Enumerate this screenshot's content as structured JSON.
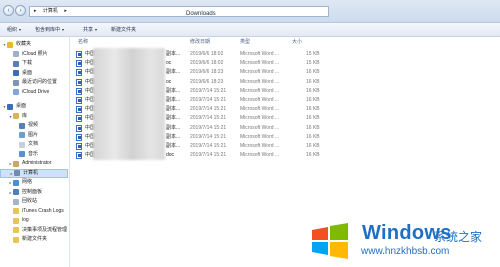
{
  "window": {
    "title": "Downloads"
  },
  "address": {
    "segments": [
      "▸",
      "计算机",
      "▸"
    ]
  },
  "toolbar": [
    {
      "label": "组织"
    },
    {
      "label": "包含到库中"
    },
    {
      "label": "共享"
    },
    {
      "label": "新建文件夹"
    }
  ],
  "sidebar": [
    {
      "label": "收藏夹",
      "indent": 0,
      "color": "#e8b830",
      "tri": "▾"
    },
    {
      "label": "iCloud 照片",
      "indent": 1,
      "color": "#9fb0c8"
    },
    {
      "label": "下载",
      "indent": 1,
      "color": "#5a7fb5"
    },
    {
      "label": "桌面",
      "indent": 1,
      "color": "#3a6fb8"
    },
    {
      "label": "最近访问的位置",
      "indent": 1,
      "color": "#7f95b8"
    },
    {
      "label": "iCloud Drive",
      "indent": 1,
      "color": "#7fa7d8"
    },
    {
      "label": "",
      "indent": 0,
      "color": "",
      "spacer": true
    },
    {
      "label": "桌面",
      "indent": 0,
      "color": "#3a6fb8",
      "tri": "▾"
    },
    {
      "label": "库",
      "indent": 1,
      "color": "#d8b45a",
      "tri": "▾"
    },
    {
      "label": "视频",
      "indent": 2,
      "color": "#5a7fb5"
    },
    {
      "label": "图片",
      "indent": 2,
      "color": "#6aa0d0"
    },
    {
      "label": "文档",
      "indent": 2,
      "color": "#c8cfd8"
    },
    {
      "label": "音乐",
      "indent": 2,
      "color": "#5b8fd0"
    },
    {
      "label": "Administrator",
      "indent": 1,
      "color": "#c8a56a",
      "tri": "▸"
    },
    {
      "label": "计算机",
      "indent": 1,
      "color": "#6f8bb0",
      "tri": "▸",
      "selected": true
    },
    {
      "label": "网络",
      "indent": 1,
      "color": "#4f8fc8",
      "tri": "▸"
    },
    {
      "label": "控制面板",
      "indent": 1,
      "color": "#4f7fb8",
      "tri": "▸"
    },
    {
      "label": "回收站",
      "indent": 1,
      "color": "#a8b4c4"
    },
    {
      "label": "iTunes Crash Logs",
      "indent": 1,
      "color": "#e8c45a"
    },
    {
      "label": "log",
      "indent": 1,
      "color": "#e8c45a"
    },
    {
      "label": "决策事项及流程管理",
      "indent": 1,
      "color": "#e8c45a"
    },
    {
      "label": "新建文件夹",
      "indent": 1,
      "color": "#e8c45a"
    }
  ],
  "columns": [
    {
      "label": "名称"
    },
    {
      "label": "修改日期"
    },
    {
      "label": "类型"
    },
    {
      "label": "大小"
    }
  ],
  "files": [
    {
      "name": "中国",
      "name2": "副本...",
      "date": "2019/6/6 18:02",
      "type": "Microsoft Word ...",
      "size": "15 KB"
    },
    {
      "name": "中国",
      "name2": "oc",
      "date": "2019/6/6 18:02",
      "type": "Microsoft Word ...",
      "size": "15 KB"
    },
    {
      "name": "中国",
      "name2": "副本...",
      "date": "2019/6/6 18:23",
      "type": "Microsoft Word ...",
      "size": "16 KB"
    },
    {
      "name": "中国",
      "name2": "oc",
      "date": "2019/6/6 18:23",
      "type": "Microsoft Word ...",
      "size": "16 KB"
    },
    {
      "name": "中国",
      "name2": "副本...",
      "date": "2019/7/14 15:21",
      "type": "Microsoft Word ...",
      "size": "16 KB"
    },
    {
      "name": "中国",
      "name2": "副本...",
      "date": "2019/7/14 15:21",
      "type": "Microsoft Word ...",
      "size": "16 KB"
    },
    {
      "name": "中国",
      "name2": "副本...",
      "date": "2019/7/14 15:21",
      "type": "Microsoft Word ...",
      "size": "16 KB"
    },
    {
      "name": "中国",
      "name2": "副本...",
      "date": "2019/7/14 15:21",
      "type": "Microsoft Word ...",
      "size": "16 KB"
    },
    {
      "name": "中国",
      "name2": "副本...",
      "date": "2019/7/14 15:21",
      "type": "Microsoft Word ...",
      "size": "16 KB"
    },
    {
      "name": "中国",
      "name2": "副本...",
      "date": "2019/7/14 15:21",
      "type": "Microsoft Word ...",
      "size": "16 KB"
    },
    {
      "name": "中国",
      "name2": "副本...",
      "date": "2019/7/14 15:21",
      "type": "Microsoft Word ...",
      "size": "16 KB"
    },
    {
      "name": "中国",
      "name2": "doc",
      "date": "2019/7/14 15:21",
      "type": "Microsoft Word ...",
      "size": "16 KB"
    }
  ],
  "watermark": {
    "brand": "Windows",
    "cn": "系统之家",
    "url": "www.hnzkhbsb.com"
  }
}
